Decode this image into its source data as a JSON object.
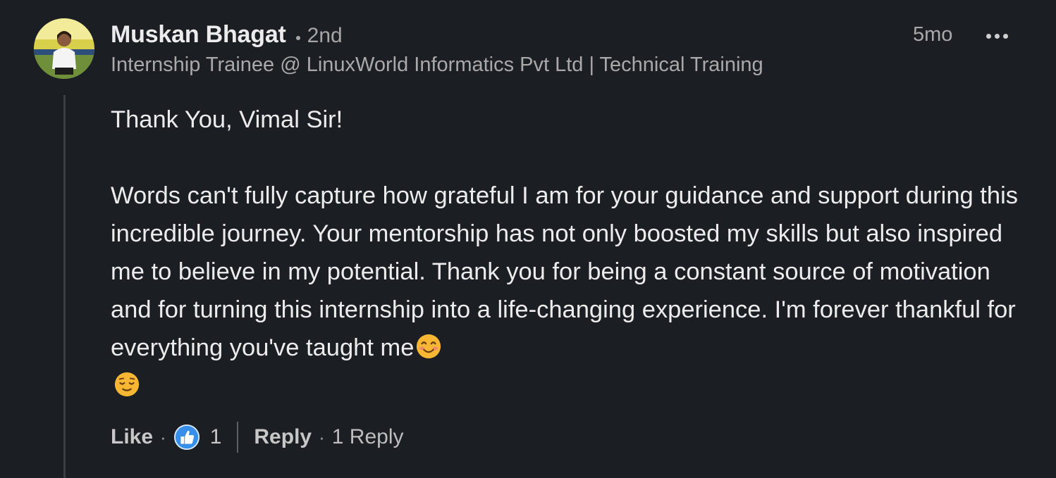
{
  "comment": {
    "author": {
      "name": "Muskan Bhagat",
      "degree": "2nd",
      "headline": "Internship Trainee @ LinuxWorld Informatics Pvt Ltd | Technical Training"
    },
    "timestamp": "5mo",
    "more_icon": "ellipsis-icon",
    "body": {
      "greeting": "Thank You, Vimal Sir!",
      "paragraph": "Words can't fully capture how grateful I am for your guidance and support during this incredible journey. Your mentorship has not only boosted my skills but also inspired me to believe in my potential. Thank you for being a constant source of motivation and for turning this internship into a life-changing experience. I'm forever thankful for everything you've taught me",
      "emojis": [
        "smiling-face-with-smiling-eyes",
        "relieved-face"
      ]
    },
    "actions": {
      "like_label": "Like",
      "reaction_icon": "thumbs-up-icon",
      "reaction_count": "1",
      "reply_label": "Reply",
      "reply_count_label": "1 Reply"
    }
  },
  "colors": {
    "background": "#1b1f23",
    "text_primary": "#ececec",
    "text_secondary": "#a9a9a9",
    "like_blue": "#378fe9"
  }
}
